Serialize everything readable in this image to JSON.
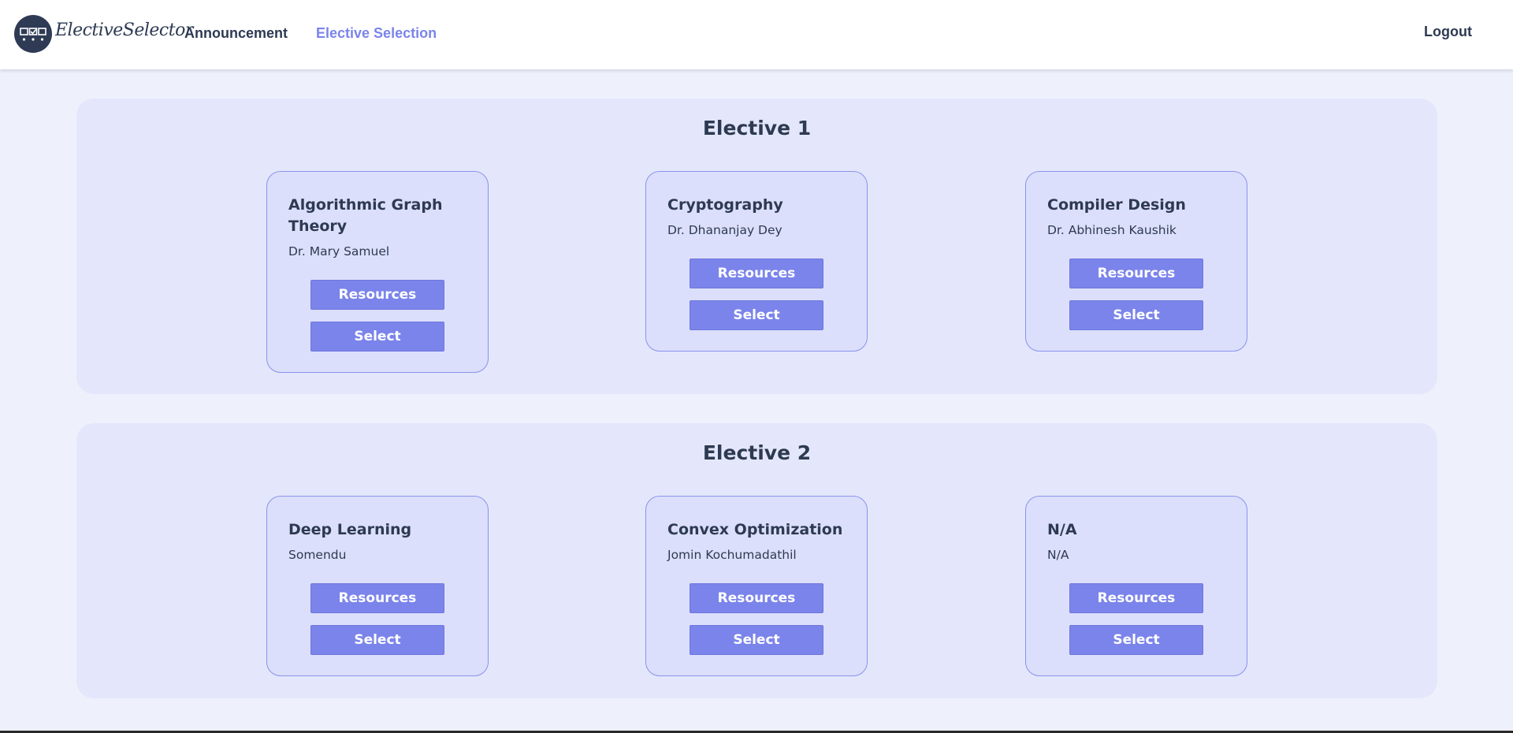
{
  "app": {
    "logo_text": "ElectiveSelector"
  },
  "nav": {
    "announcement": "Announcement",
    "elective_selection": "Elective Selection",
    "logout": "Logout"
  },
  "colors": {
    "accent": "#7b84ea",
    "text": "#2d3a52",
    "page_background": "#eef0fc",
    "section_background": "#e4e7fb",
    "card_background": "#dcdffb"
  },
  "electives": [
    {
      "title": "Elective 1",
      "courses": [
        {
          "name": "Algorithmic Graph Theory",
          "professor": "Dr. Mary Samuel",
          "resources_label": "Resources",
          "select_label": "Select"
        },
        {
          "name": "Cryptography",
          "professor": "Dr. Dhananjay Dey",
          "resources_label": "Resources",
          "select_label": "Select"
        },
        {
          "name": "Compiler Design",
          "professor": "Dr. Abhinesh Kaushik",
          "resources_label": "Resources",
          "select_label": "Select"
        }
      ]
    },
    {
      "title": "Elective 2",
      "courses": [
        {
          "name": "Deep Learning",
          "professor": "Somendu",
          "resources_label": "Resources",
          "select_label": "Select"
        },
        {
          "name": "Convex Optimization",
          "professor": "Jomin Kochumadathil",
          "resources_label": "Resources",
          "select_label": "Select"
        },
        {
          "name": "N/A",
          "professor": "N/A",
          "resources_label": "Resources",
          "select_label": "Select"
        }
      ]
    }
  ]
}
